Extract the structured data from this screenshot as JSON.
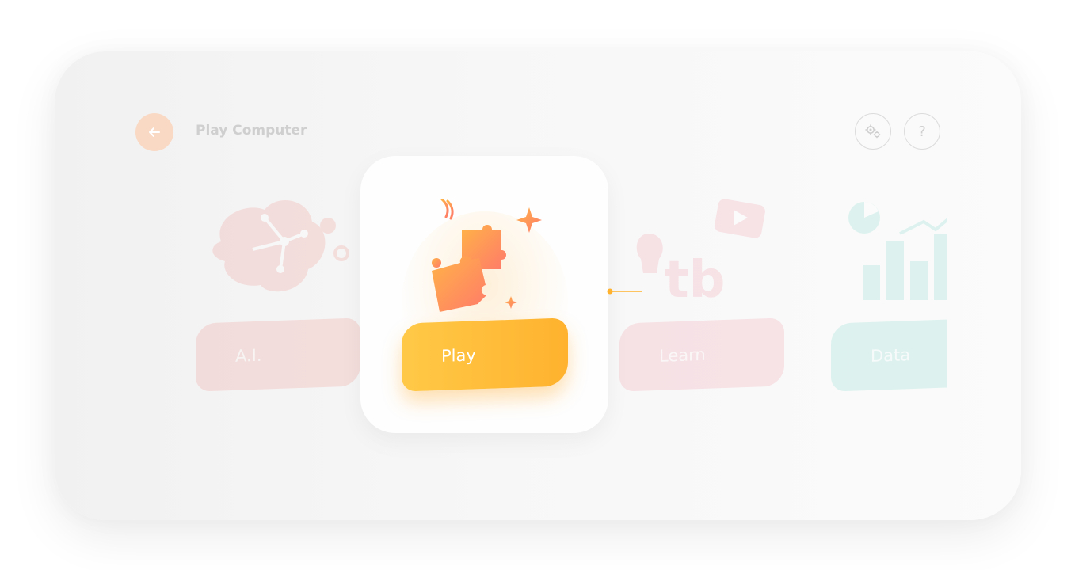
{
  "header": {
    "title": "Play Computer",
    "back_icon": "arrow-left-icon",
    "settings_icon": "gears-icon",
    "help_glyph": "?"
  },
  "carousel": {
    "items": [
      {
        "label": "A.I.",
        "icon": "brain-circuit-icon",
        "color": "#f2b4b0",
        "state": "faded"
      },
      {
        "label": "Play",
        "icon": "puzzle-icon",
        "color": "#ffb22e",
        "state": "selected"
      },
      {
        "label": "Learn",
        "icon": "tb-video-icon",
        "color": "#f5b8c3",
        "state": "faded"
      },
      {
        "label": "Data",
        "icon": "bar-chart-icon",
        "color": "#a8e6da",
        "state": "faded"
      }
    ]
  },
  "colors": {
    "accent": "#ffb22e",
    "back_button": "#f9d9c4",
    "frame": "#f4f4f4"
  }
}
